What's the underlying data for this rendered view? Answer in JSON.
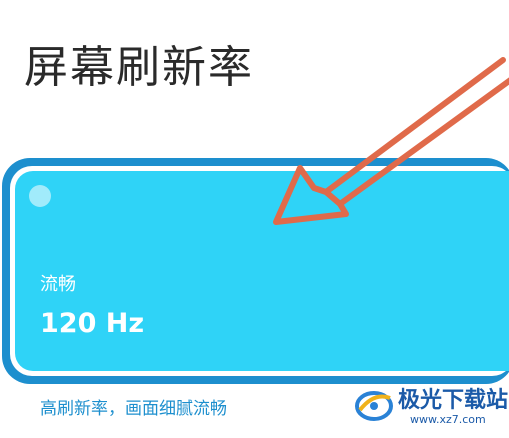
{
  "page": {
    "title": "屏幕刷新率"
  },
  "refresh_option": {
    "label": "流畅",
    "value": "120 Hz",
    "description": "高刷新率，画面细腻流畅",
    "selected": true
  },
  "colors": {
    "card_border": "#1d8fce",
    "card_fill": "#2fd3f7",
    "arrow": "#e06a4a",
    "description_text": "#1d8fce"
  },
  "watermark": {
    "brand": "极光下载站",
    "url": "www.xz7.com",
    "icon": "aurora-logo-icon"
  }
}
